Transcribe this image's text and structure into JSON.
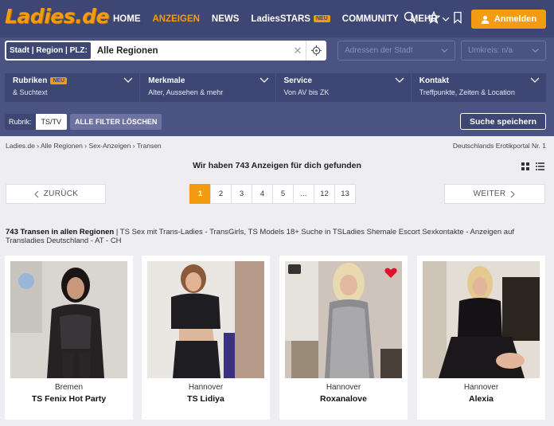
{
  "nav": {
    "logo": "Ladies.de",
    "items": [
      {
        "label": "HOME"
      },
      {
        "label": "ANZEIGEN"
      },
      {
        "label": "NEWS"
      },
      {
        "label": "LadiesSTARS",
        "badge": "NEU"
      },
      {
        "label": "COMMUNITY"
      },
      {
        "label": "MEHR"
      }
    ],
    "login": "Anmelden"
  },
  "search": {
    "label": "Stadt | Region | PLZ:",
    "value": "Alle Regionen",
    "city_placeholder": "Adressen der Stadt",
    "radius_placeholder": "Umkreis: n/a"
  },
  "filters": [
    {
      "title": "Rubriken",
      "badge": "NEU",
      "sub": "& Suchtext"
    },
    {
      "title": "Merkmale",
      "sub": "Alter, Aussehen & mehr"
    },
    {
      "title": "Service",
      "sub": "Von AV bis ZK"
    },
    {
      "title": "Kontakt",
      "sub": "Treffpunkte, Zeiten & Location"
    }
  ],
  "rubrik": {
    "label": "Rubrik:",
    "value": "TS/TV",
    "clear": "ALLE FILTER LÖSCHEN"
  },
  "save_search": "Suche speichern",
  "breadcrumb": [
    "Ladies.de",
    "Alle Regionen",
    "Sex-Anzeigen",
    "Transen"
  ],
  "portal_text": "Deutschlands Erotikportal Nr. 1",
  "found_text": "Wir haben 743 Anzeigen für dich gefunden",
  "pagination": {
    "prev": "ZURÜCK",
    "next": "WEITER",
    "pages": [
      "1",
      "2",
      "3",
      "4",
      "5",
      "...",
      "12",
      "13"
    ],
    "active": "1"
  },
  "description": {
    "bold": "743 Transen in allen Regionen",
    "text": " | TS Sex mit Trans-Ladies - TransGirls, TS Models 18+ Suche in TSLadies Shemale Escort Sexkontakte - Anzeigen auf Transladies Deutschland - AT - CH"
  },
  "cards": [
    {
      "city": "Bremen",
      "name": "TS Fenix Hot Party"
    },
    {
      "city": "Hannover",
      "name": "TS Lidiya"
    },
    {
      "city": "Hannover",
      "name": "Roxanalove"
    },
    {
      "city": "Hannover",
      "name": "Alexia"
    }
  ],
  "colors": {
    "accent": "#f39c12",
    "nav_bg": "#3e4673",
    "search_bg": "#4b5382"
  }
}
